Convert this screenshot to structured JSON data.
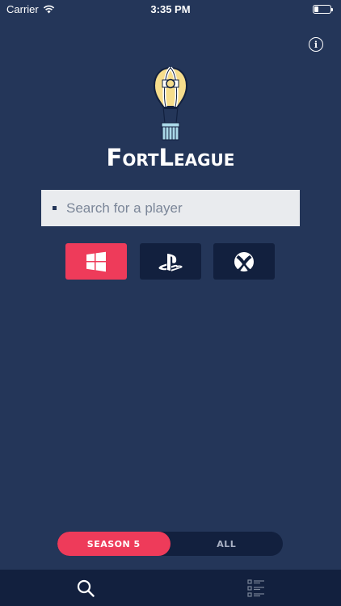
{
  "status_bar": {
    "carrier": "Carrier",
    "time": "3:35 PM"
  },
  "app": {
    "title": "FortLeague"
  },
  "search": {
    "placeholder": "Search for a player"
  },
  "platforms": [
    {
      "name": "pc",
      "icon": "windows-icon",
      "selected": true
    },
    {
      "name": "playstation",
      "icon": "playstation-icon",
      "selected": false
    },
    {
      "name": "xbox",
      "icon": "xbox-icon",
      "selected": false
    }
  ],
  "season_toggle": {
    "options": [
      {
        "label": "Season 5",
        "active": true
      },
      {
        "label": "All",
        "active": false
      }
    ]
  },
  "tab_bar": {
    "tabs": [
      {
        "icon": "search-icon",
        "active": true
      },
      {
        "icon": "list-icon",
        "active": false
      }
    ]
  },
  "colors": {
    "background": "#243659",
    "dark_navy": "#12203e",
    "accent": "#ee3b5a",
    "search_bg": "#e9ebee",
    "balloon_yellow": "#f6dd8c",
    "basket_blue": "#a9d8e8"
  }
}
